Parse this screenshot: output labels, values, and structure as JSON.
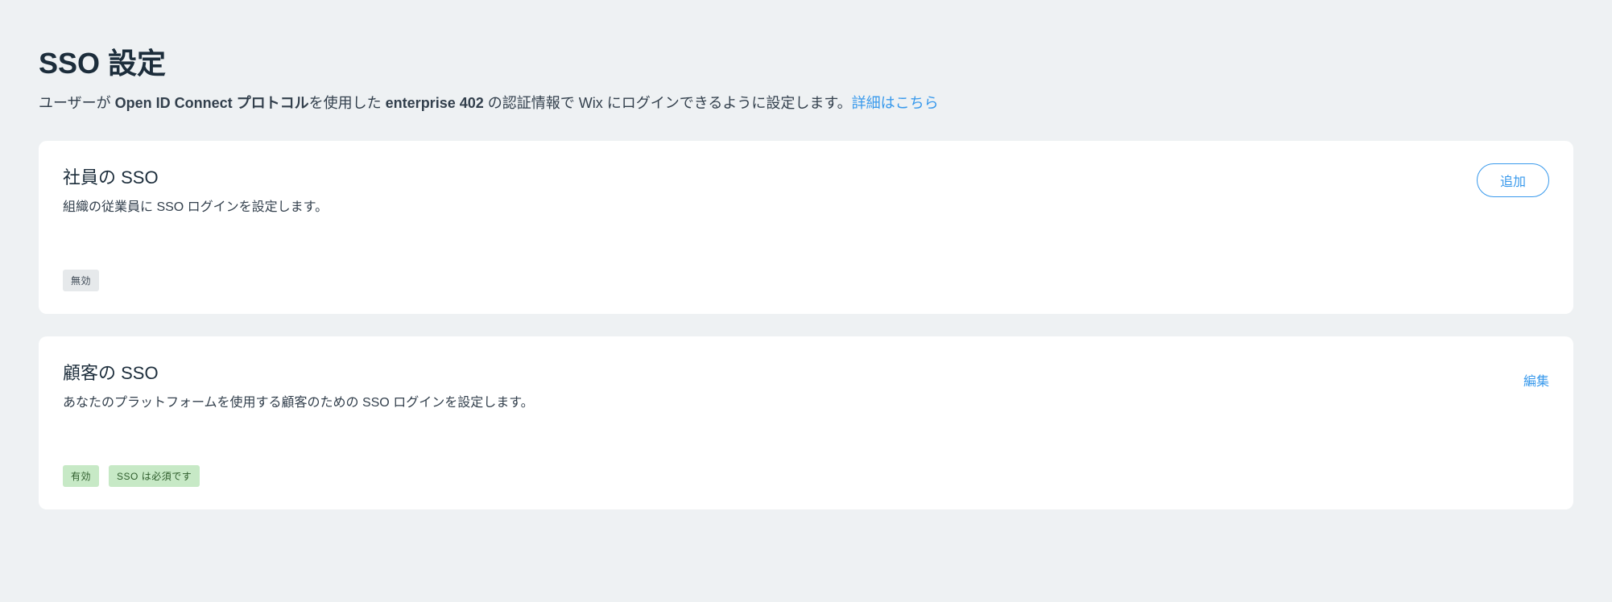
{
  "header": {
    "title": "SSO 設定",
    "description_prefix": "ユーザーが ",
    "description_bold1": "Open ID Connect プロトコル",
    "description_mid1": "を使用した ",
    "description_bold2": "enterprise 402",
    "description_suffix": " の認証情報で Wix にログインできるように設定します。",
    "more_link": "詳細はこちら"
  },
  "cards": {
    "employee": {
      "title": "社員の SSO",
      "description": "組織の従業員に SSO ログインを設定します。",
      "action_label": "追加",
      "badges": [
        {
          "text": "無効",
          "style": "gray"
        }
      ]
    },
    "customer": {
      "title": "顧客の SSO",
      "description": "あなたのプラットフォームを使用する顧客のための SSO ログインを設定します。",
      "action_label": "編集",
      "badges": [
        {
          "text": "有効",
          "style": "green"
        },
        {
          "text": "SSO は必須です",
          "style": "green"
        }
      ]
    }
  }
}
